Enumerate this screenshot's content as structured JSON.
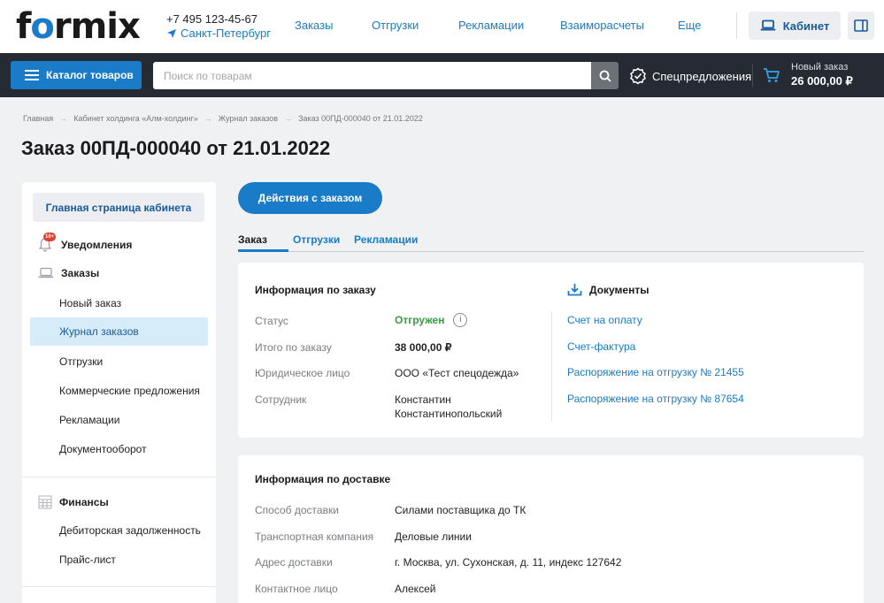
{
  "header": {
    "logo_pre": "f",
    "logo_o": "o",
    "logo_post": "rmix",
    "phone": "+7 495 123-45-67",
    "city": "Санкт-Петербург",
    "nav": [
      "Заказы",
      "Отгрузки",
      "Рекламации",
      "Взаиморасчеты",
      "Еще"
    ],
    "cabinet_label": "Кабинет"
  },
  "toolbar": {
    "catalog_label": "Каталог товаров",
    "search_placeholder": "Поиск по товарам",
    "special_label": "Спецпредложения",
    "cart_label": "Новый заказ",
    "cart_sum": "26 000,00 ₽"
  },
  "breadcrumb": [
    "Главная",
    "Кабинет холдинга «Алм-холдинг»",
    "Журнал заказов",
    "Заказ 00ПД-000040 от 21.01.2022"
  ],
  "page_title": "Заказ 00ПД-000040 от 21.01.2022",
  "sidebar": {
    "home_label": "Главная страница кабинета",
    "notifications_label": "Уведомления",
    "notifications_badge": "10+",
    "orders_label": "Заказы",
    "orders_items": [
      "Новый заказ",
      "Журнал заказов",
      "Отгрузки",
      "Коммерческие предложения",
      "Рекламации",
      "Документооборот"
    ],
    "finance_label": "Финансы",
    "finance_items": [
      "Дебиторская задолженность",
      "Прайс-лист"
    ]
  },
  "main": {
    "actions_label": "Действия с заказом",
    "tabs": [
      "Заказ",
      "Отгрузки",
      "Рекламации"
    ],
    "order_info": {
      "title": "Информация по заказу",
      "rows": [
        {
          "label": "Статус",
          "value": "Отгружен"
        },
        {
          "label": "Итого по заказу",
          "value": "38 000,00 ₽"
        },
        {
          "label": "Юридическое лицо",
          "value": "ООО «Тест спецодежда»"
        },
        {
          "label": "Сотрудник",
          "value": "Константин Константинопольский"
        }
      ]
    },
    "documents": {
      "title": "Документы",
      "links": [
        "Счет на оплату",
        "Счет-фактура",
        "Распоряжение на отгрузку № 21455",
        "Распоряжение на отгрузку № 87654"
      ]
    },
    "delivery_info": {
      "title": "Информация по доставке",
      "rows": [
        {
          "label": "Способ доставки",
          "value": "Силами поставщика до ТК"
        },
        {
          "label": "Транспортная компания",
          "value": "Деловые линии"
        },
        {
          "label": "Адрес доставки",
          "value": "г. Москва, ул. Сухонская, д. 11, индекс 127642"
        },
        {
          "label": "Контактное лицо",
          "value": "Алексей"
        }
      ]
    }
  },
  "colors": {
    "accent": "#1a7bc9",
    "dark_bar": "#262b33",
    "status_ok": "#3a9a45",
    "badge": "#e03e2f"
  }
}
